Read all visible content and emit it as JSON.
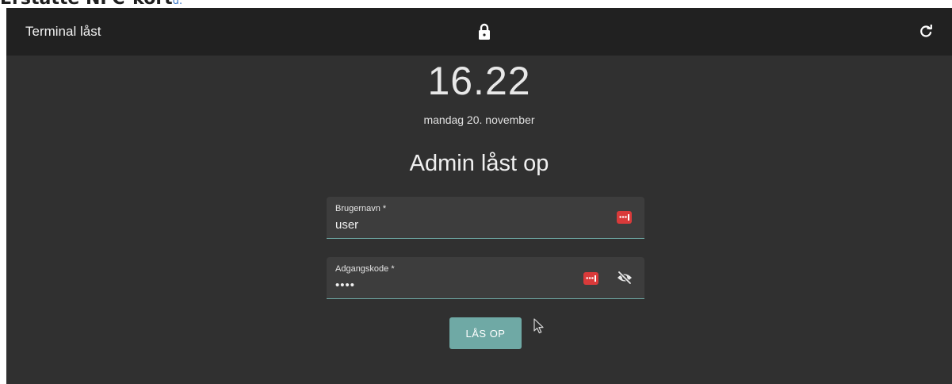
{
  "page_heading": {
    "text": "Erstatte NFC-kort",
    "tail": "d."
  },
  "topbar": {
    "title": "Terminal låst",
    "center_icon": "lock-icon",
    "right_icon": "refresh-icon"
  },
  "clock": {
    "time": "16.22",
    "date": "mandag 20. november"
  },
  "form": {
    "title": "Admin låst op",
    "username": {
      "label": "Brugernavn *",
      "value": "user"
    },
    "password": {
      "label": "Adgangskode *",
      "value": "••••"
    },
    "submit_label": "LÅS OP"
  },
  "colors": {
    "topbar_bg": "#212121",
    "page_bg": "#303030",
    "field_bg": "#3d3d3d",
    "accent": "#6fa9a5",
    "password_manager_badge": "#d93a3a"
  }
}
